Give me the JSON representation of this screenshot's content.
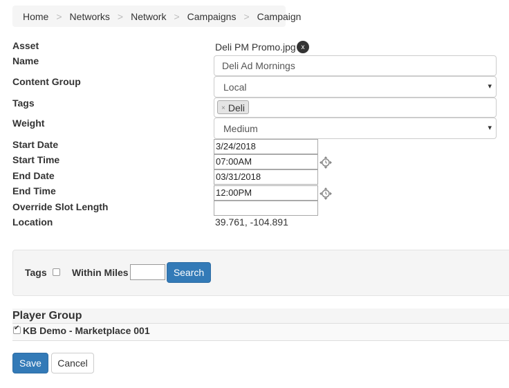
{
  "breadcrumb": [
    "Home",
    "Networks",
    "Network",
    "Campaigns",
    "Campaign"
  ],
  "breadcrumb_separator": ">",
  "form": {
    "asset": {
      "label": "Asset",
      "value": "Deli PM Promo.jpg",
      "remove_glyph": "x"
    },
    "name": {
      "label": "Name",
      "value": "Deli Ad Mornings"
    },
    "content_group": {
      "label": "Content Group",
      "selected": "Local",
      "caret": "▾"
    },
    "tags": {
      "label": "Tags",
      "chips": [
        "Deli"
      ],
      "chip_remove_glyph": "×"
    },
    "weight": {
      "label": "Weight",
      "selected": "Medium",
      "caret": "▾"
    },
    "start_date": {
      "label": "Start Date",
      "value": "3/24/2018"
    },
    "start_time": {
      "label": "Start Time",
      "value": "07:00AM"
    },
    "end_date": {
      "label": "End Date",
      "value": "03/31/2018"
    },
    "end_time": {
      "label": "End Time",
      "value": "12:00PM"
    },
    "override_slot_length": {
      "label": "Override Slot Length",
      "value": ""
    },
    "location": {
      "label": "Location",
      "value": "39.761, -104.891"
    }
  },
  "filter": {
    "tags_label": "Tags",
    "tags_checked": false,
    "within_miles_label": "Within Miles",
    "within_miles_value": "",
    "search_label": "Search"
  },
  "player_group": {
    "title": "Player Group",
    "items": [
      {
        "label": "KB Demo - Marketplace 001",
        "checked": true
      }
    ]
  },
  "actions": {
    "save_label": "Save",
    "cancel_label": "Cancel"
  },
  "colors": {
    "primary": "#337ab7",
    "panel": "#f5f5f5",
    "border": "#cccccc"
  },
  "icons": {
    "time_picker": "clock-picker-icon",
    "asset_remove": "close-icon"
  }
}
